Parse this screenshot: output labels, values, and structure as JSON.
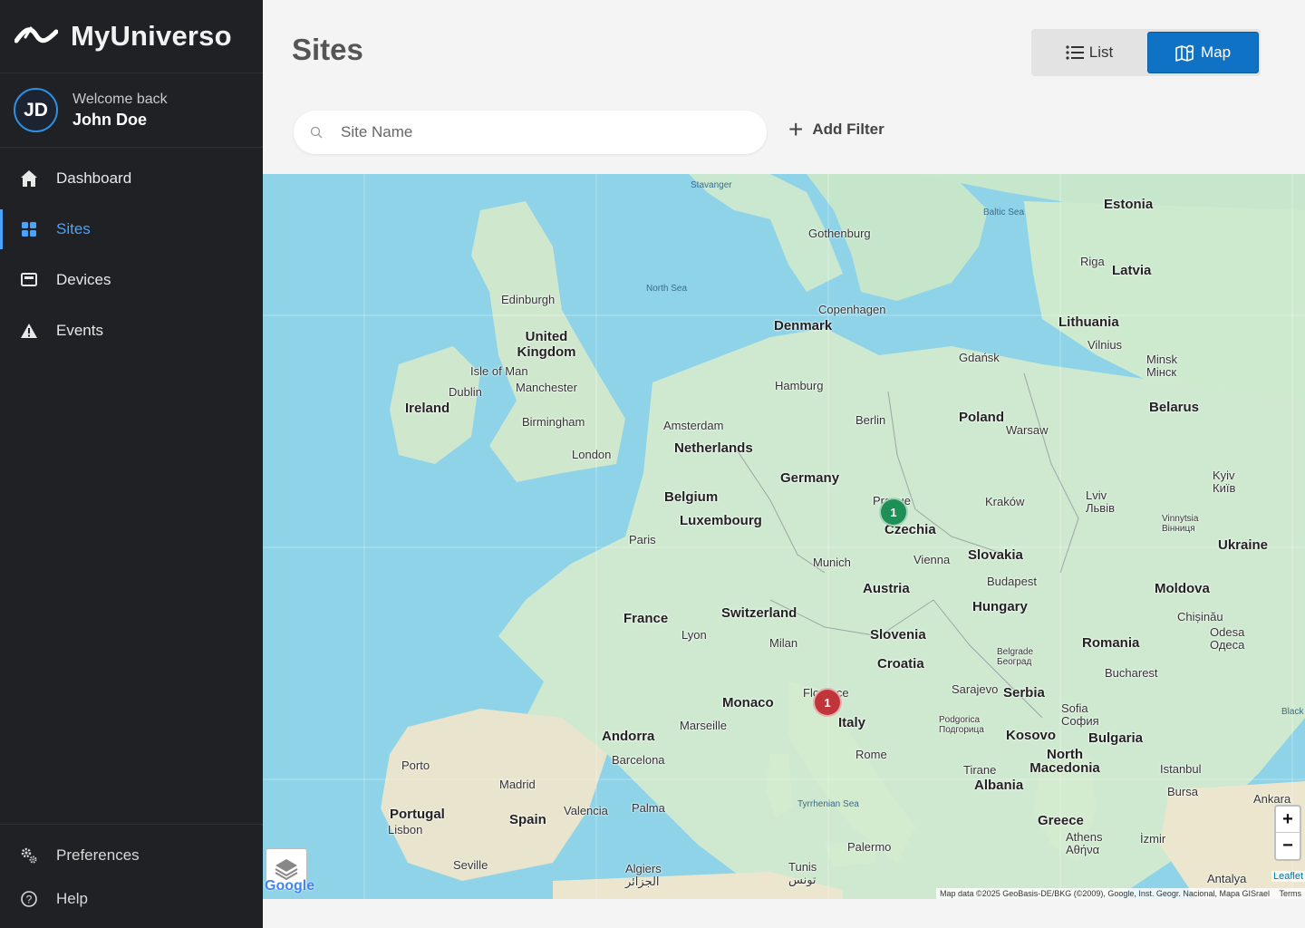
{
  "brand": {
    "name": "MyUniverso"
  },
  "user": {
    "initials": "JD",
    "welcome": "Welcome back",
    "name": "John Doe"
  },
  "sidebar": {
    "items": [
      {
        "label": "Dashboard",
        "icon": "home-icon"
      },
      {
        "label": "Sites",
        "icon": "grid-icon",
        "active": true
      },
      {
        "label": "Devices",
        "icon": "device-icon"
      },
      {
        "label": "Events",
        "icon": "warning-icon"
      }
    ],
    "bottom": [
      {
        "label": "Preferences",
        "icon": "gears-icon"
      },
      {
        "label": "Help",
        "icon": "help-icon"
      }
    ]
  },
  "page": {
    "title": "Sites"
  },
  "view_toggle": {
    "list_label": "List",
    "map_label": "Map",
    "selected": "Map"
  },
  "search": {
    "placeholder": "Site Name",
    "value": ""
  },
  "filter": {
    "add_label": "Add Filter"
  },
  "map": {
    "seas": [
      "Stavanger",
      "Baltic Sea",
      "North Sea",
      "Tyrrhenian Sea",
      "Black"
    ],
    "countries": [
      "Estonia",
      "Latvia",
      "Lithuania",
      "Denmark",
      "United Kingdom",
      "Ireland",
      "Netherlands",
      "Belgium",
      "Luxembourg",
      "Germany",
      "Poland",
      "Belarus",
      "Czechia",
      "Slovakia",
      "Austria",
      "Hungary",
      "Ukraine",
      "Moldova",
      "Romania",
      "Switzerland",
      "France",
      "Slovenia",
      "Croatia",
      "Serbia",
      "Bulgaria",
      "Kosovo",
      "North Macedonia",
      "Albania",
      "Greece",
      "Monaco",
      "Andorra",
      "Italy",
      "Portugal",
      "Spain"
    ],
    "cities": [
      "Gothenburg",
      "Riga",
      "Copenhagen",
      "Edinburgh",
      "Isle of Man",
      "Dublin",
      "Manchester",
      "Birmingham",
      "London",
      "Amsterdam",
      "Hamburg",
      "Berlin",
      "Gdańsk",
      "Vilnius",
      "Minsk Мінск",
      "Warsaw",
      "Kraków",
      "Lviv Львів",
      "Kyiv Київ",
      "Vinnytsia Вінниця",
      "Prague",
      "Vienna",
      "Budapest",
      "Munich",
      "Paris",
      "Lyon",
      "Milan",
      "Florence",
      "Marseille",
      "Barcelona",
      "Rome",
      "Porto",
      "Madrid",
      "Lisbon",
      "Valencia",
      "Palma",
      "Seville",
      "Algiers الجزائر",
      "Tunis تونس",
      "Palermo",
      "Sarajevo",
      "Belgrade Београд",
      "Podgorica Подгорица",
      "Sofia София",
      "Bucharest",
      "Chișinău",
      "Odesa Одеса",
      "Tirane",
      "Istanbul",
      "Bursa",
      "Ankara",
      "İzmir",
      "Athens Αθήνα",
      "Antalya"
    ],
    "markers": [
      {
        "label": "1",
        "color": "#1e8f55",
        "near": "Prague"
      },
      {
        "label": "1",
        "color": "#c0353a",
        "near": "Florence"
      }
    ],
    "zoom_in": "+",
    "zoom_out": "−",
    "google_logo": "Google",
    "leaflet": "Leaflet",
    "attribution": "Map data ©2025 GeoBasis-DE/BKG (©2009), Google, Inst. Geogr. Nacional, Mapa GISrael",
    "terms": "Terms"
  }
}
